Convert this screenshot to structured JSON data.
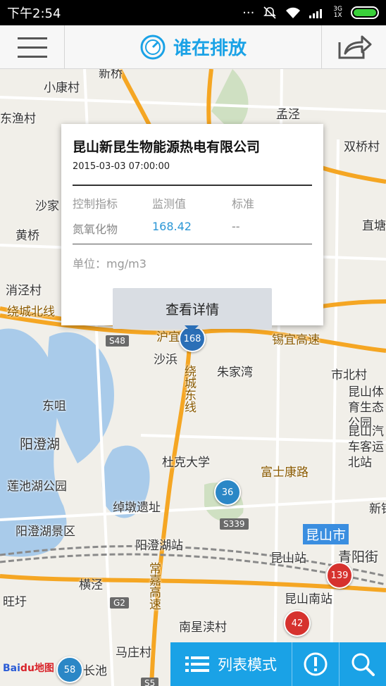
{
  "status_bar": {
    "time": "下午2:54",
    "net": "3G\n1X"
  },
  "header": {
    "title": "谁在排放"
  },
  "popup": {
    "company": "昆山新昆生物能源热电有限公司",
    "datetime": "2015-03-03 07:00:00",
    "columns": [
      "控制指标",
      "监测值",
      "标准"
    ],
    "indicator": "氮氧化物",
    "value": "168.42",
    "standard": "--",
    "unit_label": "单位：mg/m3",
    "detail_button": "查看详情"
  },
  "stations": [
    {
      "value": "168",
      "color": "#2b6fb7"
    },
    {
      "value": "36",
      "color": "#2b87c6"
    },
    {
      "value": "139",
      "color": "#d6322e"
    },
    {
      "value": "42",
      "color": "#d6322e"
    },
    {
      "value": "58",
      "color": "#2b87c6"
    }
  ],
  "map": {
    "places": [
      "新桥",
      "小康村",
      "东渔村",
      "孟泾",
      "双桥村",
      "沙家",
      "黄桥",
      "直塘",
      "消泾村",
      "绕城北线",
      "沪宜高速",
      "锡宜高速",
      "沙浜",
      "朱家湾",
      "市北村",
      "东咀",
      "绕城东线",
      "昆山体育生态公园",
      "阳澄湖",
      "昆山汽车客运北站",
      "杜克大学",
      "富士康路",
      "莲池湖公园",
      "绰墩遗址",
      "新镇",
      "阳澄湖景区",
      "阳澄湖站",
      "昆山市",
      "昆山站",
      "青阳街",
      "横泾",
      "常嘉高速",
      "昆山南站",
      "旺圩",
      "南星渎村",
      "马庄村",
      "长池"
    ],
    "shields": [
      "S48",
      "S339",
      "G2",
      "S5"
    ],
    "attribution": "地图"
  },
  "bottom_bar": {
    "list_mode": "列表模式"
  },
  "colors": {
    "accent": "#1aa2e6",
    "value_blue": "#2b97d6"
  }
}
